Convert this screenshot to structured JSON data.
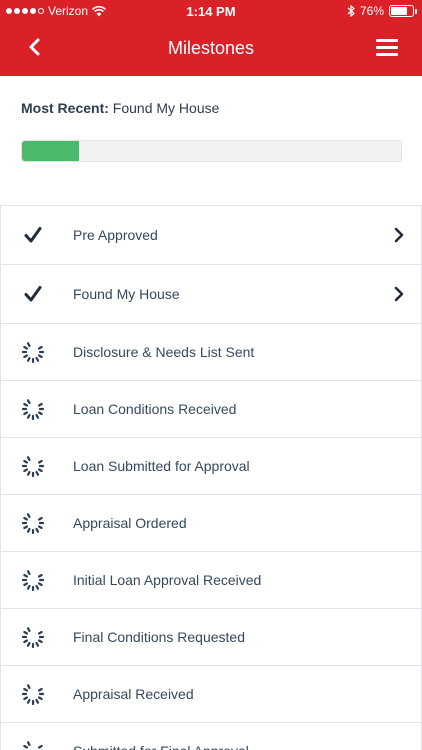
{
  "status_bar": {
    "carrier": "Verizon",
    "time": "1:14 PM",
    "battery_text": "76%",
    "battery_level": 0.76,
    "signal_bars_filled": 4,
    "signal_bars_total": 5
  },
  "header": {
    "title": "Milestones",
    "back_icon": "chevron-left-icon",
    "menu_icon": "hamburger-menu-icon",
    "background_color": "#db2128"
  },
  "summary": {
    "most_recent_label": "Most Recent:",
    "most_recent_value": "Found My House",
    "progress_fraction": 0.15,
    "progress_color": "#4cb86a"
  },
  "milestones": [
    {
      "label": "Pre Approved",
      "status": "complete",
      "icon": "checkmark-icon",
      "has_chevron": true
    },
    {
      "label": "Found My House",
      "status": "complete",
      "icon": "checkmark-icon",
      "has_chevron": true
    },
    {
      "label": "Disclosure & Needs List Sent",
      "status": "pending",
      "icon": "loading-spinner-icon",
      "has_chevron": false
    },
    {
      "label": "Loan Conditions Received",
      "status": "pending",
      "icon": "loading-spinner-icon",
      "has_chevron": false
    },
    {
      "label": "Loan Submitted for Approval",
      "status": "pending",
      "icon": "loading-spinner-icon",
      "has_chevron": false
    },
    {
      "label": "Appraisal Ordered",
      "status": "pending",
      "icon": "loading-spinner-icon",
      "has_chevron": false
    },
    {
      "label": "Initial Loan Approval Received",
      "status": "pending",
      "icon": "loading-spinner-icon",
      "has_chevron": false
    },
    {
      "label": "Final Conditions Requested",
      "status": "pending",
      "icon": "loading-spinner-icon",
      "has_chevron": false
    },
    {
      "label": "Appraisal Received",
      "status": "pending",
      "icon": "loading-spinner-icon",
      "has_chevron": false
    },
    {
      "label": "Submitted for Final Approval",
      "status": "pending",
      "icon": "loading-spinner-icon",
      "has_chevron": false
    }
  ]
}
